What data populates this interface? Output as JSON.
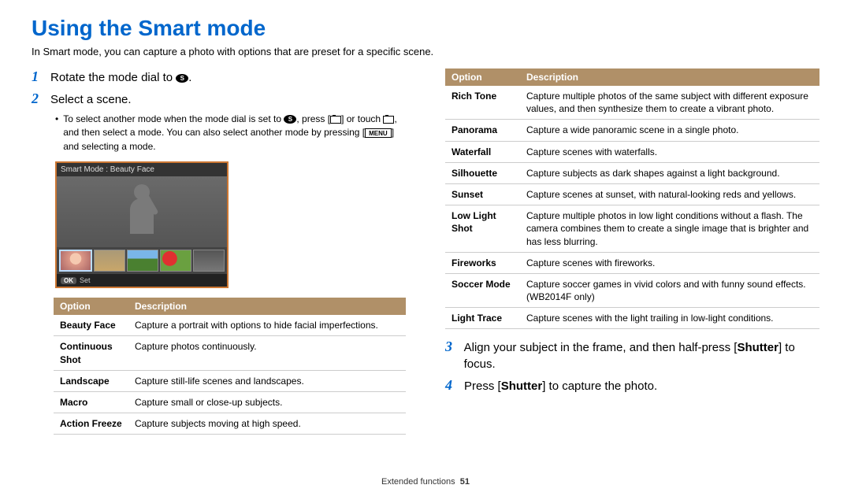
{
  "title": "Using the Smart mode",
  "intro": "In Smart mode, you can capture a photo with options that are preset for a specific scene.",
  "steps": {
    "s1_pre": "Rotate the mode dial to ",
    "s1_post": ".",
    "s2": "Select a scene.",
    "s3_pre": "Align your subject in the frame, and then half-press [",
    "s3_bold": "Shutter",
    "s3_post": "] to focus.",
    "s4_pre": "Press [",
    "s4_bold": "Shutter",
    "s4_post": "] to capture the photo."
  },
  "bullet": {
    "pre": "To select another mode when the mode dial is set to ",
    "mid1": ", press [",
    "mid2": "] or touch ",
    "mid3": ", and then select a mode. You can also select another mode by pressing [",
    "menu_label": "MENU",
    "post": "] and selecting a mode."
  },
  "illus": {
    "top": "Smart Mode : Beauty Face",
    "ok": "OK",
    "set": "Set"
  },
  "table_headers": {
    "option": "Option",
    "description": "Description"
  },
  "table_left": [
    {
      "opt": "Beauty Face",
      "desc": "Capture a portrait with options to hide facial imperfections."
    },
    {
      "opt": "Continuous Shot",
      "desc": "Capture photos continuously."
    },
    {
      "opt": "Landscape",
      "desc": "Capture still-life scenes and landscapes."
    },
    {
      "opt": "Macro",
      "desc": "Capture small or close-up subjects."
    },
    {
      "opt": "Action Freeze",
      "desc": "Capture subjects moving at high speed."
    }
  ],
  "table_right": [
    {
      "opt": "Rich Tone",
      "desc": "Capture multiple photos of the same subject with different exposure values, and then synthesize them to create a vibrant photo."
    },
    {
      "opt": "Panorama",
      "desc": "Capture a wide panoramic scene in a single photo."
    },
    {
      "opt": "Waterfall",
      "desc": "Capture scenes with waterfalls."
    },
    {
      "opt": "Silhouette",
      "desc": "Capture subjects as dark shapes against a light background."
    },
    {
      "opt": "Sunset",
      "desc": "Capture scenes at sunset, with natural-looking reds and yellows."
    },
    {
      "opt": "Low Light Shot",
      "desc": "Capture multiple photos in low light conditions without a flash. The camera combines them to create a single image that is brighter and has less blurring."
    },
    {
      "opt": "Fireworks",
      "desc": "Capture scenes with fireworks."
    },
    {
      "opt": "Soccer Mode",
      "desc": "Capture soccer games in vivid colors and with funny sound effects. (WB2014F only)"
    },
    {
      "opt": "Light Trace",
      "desc": "Capture scenes with the light trailing in low-light conditions."
    }
  ],
  "footer": {
    "section": "Extended functions",
    "page": "51"
  },
  "smart_symbol": "S"
}
